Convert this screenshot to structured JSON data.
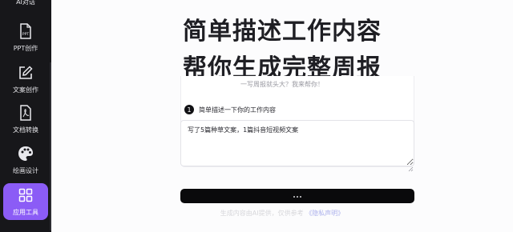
{
  "sidebar": {
    "items": [
      {
        "label": "AI对话",
        "icon": "chat-icon"
      },
      {
        "label": "PPT创作",
        "icon": "ppt-file-icon",
        "badge": "PPT"
      },
      {
        "label": "文案创作",
        "icon": "edit-icon"
      },
      {
        "label": "文档转换",
        "icon": "pdf-file-icon"
      },
      {
        "label": "绘画设计",
        "icon": "palette-icon"
      },
      {
        "label": "应用工具",
        "icon": "apps-grid-icon",
        "active": true
      }
    ]
  },
  "main": {
    "title_line1": "简单描述工作内容",
    "title_line2": "帮你生成完整周报",
    "subtitle": "一写周报就头大？我来帮你！",
    "step": {
      "number": "1",
      "label": "简单描述一下你的工作内容"
    },
    "work_input": {
      "value": "写了5篇种草文案，1篇抖音短视频文案"
    },
    "submit_loading": true,
    "footer": {
      "text": "生成内容由AI提供，仅供参考",
      "link": "《隐私声明》"
    }
  },
  "colors": {
    "sidebar_bg": "#17171a",
    "accent": "#8b5cf6",
    "button_bg": "#0a0a0c",
    "title": "#1f1f24"
  }
}
